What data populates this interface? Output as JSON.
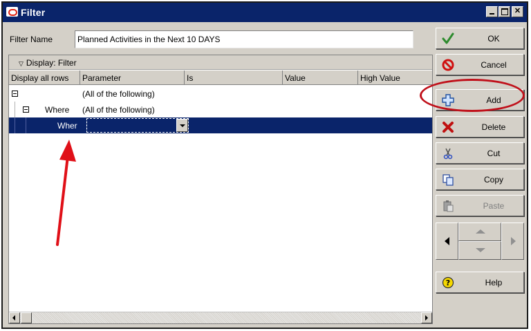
{
  "window": {
    "title": "Filter",
    "controls": [
      "minimize-icon",
      "maximize-icon",
      "close-icon"
    ]
  },
  "filter_name": {
    "label": "Filter Name",
    "value": "Planned Activities in the Next 10 DAYS"
  },
  "display": {
    "header": "Display: Filter",
    "columns": [
      "Display all rows",
      "Parameter",
      "Is",
      "Value",
      "High Value"
    ]
  },
  "rows": [
    {
      "col0": "",
      "parameter": "(All of the following)"
    },
    {
      "col0": "Where",
      "parameter": "(All of the following)"
    },
    {
      "col0": "Wher",
      "parameter": ""
    }
  ],
  "buttons": {
    "ok": "OK",
    "cancel": "Cancel",
    "add": "Add",
    "delete": "Delete",
    "cut": "Cut",
    "copy": "Copy",
    "paste": "Paste",
    "help": "Help"
  },
  "colors": {
    "titlebar": "#0a246a",
    "selection": "#0a246a",
    "annotation": "#c0101a"
  }
}
